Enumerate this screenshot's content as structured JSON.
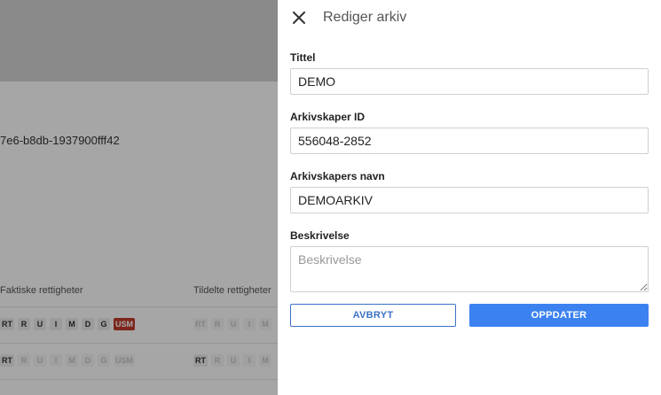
{
  "background": {
    "id_text": "7e6-b8db-1937900fff42",
    "col1_header": "Faktiske rettigheter",
    "col2_header": "Tildelte rettigheter",
    "rows": [
      {
        "actual": [
          "RT",
          "R",
          "U",
          "I",
          "M",
          "D",
          "G",
          "USM"
        ],
        "assigned": [
          "RT",
          "R",
          "U",
          "I",
          "M"
        ]
      },
      {
        "actual": [
          "RT",
          "R",
          "U",
          "I",
          "M",
          "D",
          "G",
          "USM"
        ],
        "assigned": [
          "RT",
          "R",
          "U",
          "I",
          "M"
        ]
      }
    ]
  },
  "panel": {
    "title": "Rediger arkiv",
    "fields": {
      "tittel": {
        "label": "Tittel",
        "value": "DEMO"
      },
      "arkivskaper_id": {
        "label": "Arkivskaper ID",
        "value": "556048-2852"
      },
      "arkivskapers_navn": {
        "label": "Arkivskapers navn",
        "value": "DEMOARKIV"
      },
      "beskrivelse": {
        "label": "Beskrivelse",
        "value": "",
        "placeholder": "Beskrivelse"
      }
    },
    "buttons": {
      "cancel": "AVBRYT",
      "update": "OPPDATER"
    }
  },
  "colors": {
    "primary": "#3b82f0",
    "cancel_border": "#3d72c7",
    "badge_red": "#c0392b"
  }
}
